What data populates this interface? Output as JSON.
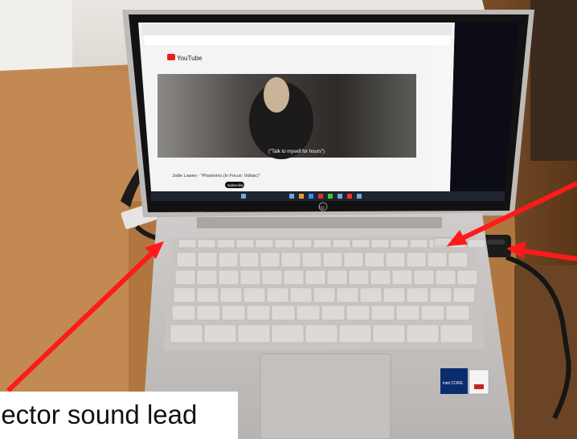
{
  "caption": {
    "text": "jector sound lead"
  },
  "screen": {
    "site_name": "YouTube",
    "subtitle": "(\"Talk to myself for hours\")",
    "video_title": "Jodie Lawes - \"Phantoms (In Focus: Voltaic)\"",
    "subscribe_label": "Subscribe",
    "logo_text": "hp",
    "intel_badge": "intel CORE"
  },
  "annotations": {
    "arrow_color": "#ff1a1a",
    "arrows": [
      {
        "name": "arrow-to-left-port",
        "target": "laptop-left-side-port"
      },
      {
        "name": "arrow-to-function-key",
        "target": "keyboard-function-key"
      },
      {
        "name": "arrow-to-usb-adapter",
        "target": "usb-adapter"
      }
    ]
  }
}
